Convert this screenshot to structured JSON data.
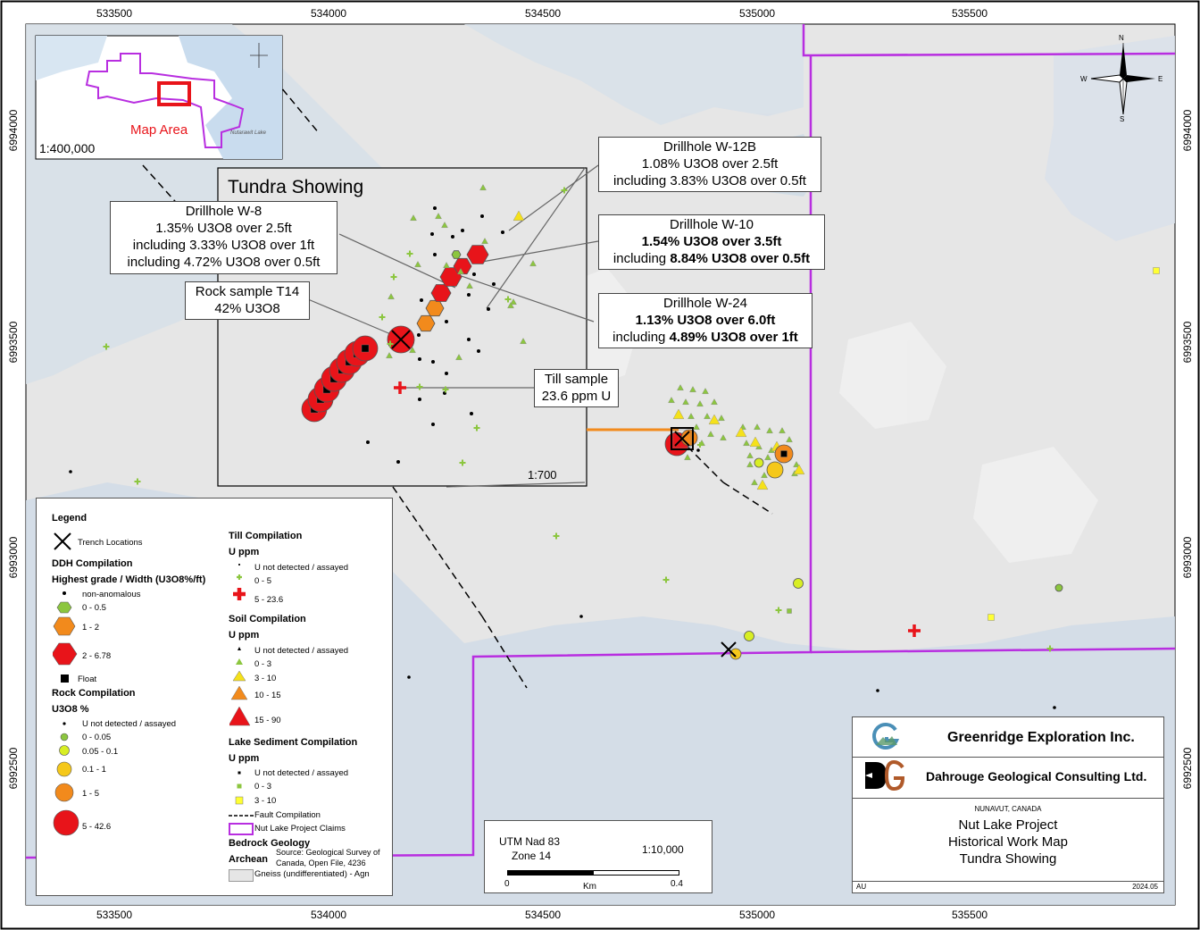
{
  "axes": {
    "easting_ticks": [
      "533500",
      "534000",
      "534500",
      "535000",
      "535500"
    ],
    "northing_ticks": [
      "6994000",
      "6993500",
      "6993000",
      "6992500"
    ]
  },
  "inset": {
    "label": "Map Area",
    "scale": "1:400,000",
    "lake_text": "Nutarawit Lake"
  },
  "detail": {
    "title": "Tundra Showing",
    "scale": "1:700"
  },
  "callouts": {
    "w12b": {
      "title": "Drillhole W-12B",
      "l1": "1.08% U3O8 over 2.5ft",
      "l2": "including 3.83% U3O8 over 0.5ft"
    },
    "w8": {
      "title": "Drillhole W-8",
      "l1": "1.35% U3O8 over 2.5ft",
      "l2": "including 3.33% U3O8 over 1ft",
      "l3": "including 4.72% U3O8 over 0.5ft"
    },
    "w10": {
      "title": "Drillhole W-10",
      "l1": "1.54% U3O8 over 3.5ft",
      "l2a": "including ",
      "l2b": "8.84% U3O8 over 0.5ft"
    },
    "w24": {
      "title": "Drillhole W-24",
      "l1": "1.13% U3O8 over 6.0ft",
      "l2a": "including ",
      "l2b": "4.89% U3O8 over 1ft"
    },
    "t14": {
      "title": "Rock sample T14",
      "l1": "42% U3O8"
    },
    "till": {
      "title": "Till sample",
      "l1": "23.6 ppm U"
    }
  },
  "legend": {
    "title": "Legend",
    "trench": "Trench Locations",
    "ddh_h": "DDH Compilation",
    "ddh_sub": "Highest grade / Width (U3O8%/ft)",
    "ddh_items": [
      "non-anomalous",
      "0 - 0.5",
      "1 - 2",
      "2 - 6.78",
      "Float"
    ],
    "rock_h": "Rock Compilation",
    "rock_sub": "U3O8 %",
    "rock_items": [
      "U not detected / assayed",
      "0 - 0.05",
      "0.05 - 0.1",
      "0.1 - 1",
      "1 - 5",
      "5 - 42.6"
    ],
    "till_h": "Till Compilation",
    "till_sub": "U ppm",
    "till_items": [
      "U not detected / assayed",
      "0 - 5",
      "5 - 23.6"
    ],
    "soil_h": "Soil Compilation",
    "soil_sub": "U ppm",
    "soil_items": [
      "U not detected / assayed",
      "0 - 3",
      "3 - 10",
      "10 - 15",
      "15 - 90"
    ],
    "lake_h": "Lake Sediment Compilation",
    "lake_sub": "U ppm",
    "lake_items": [
      "U not detected / assayed",
      "0 - 3",
      "3 - 10"
    ],
    "fault": "Fault Compilation",
    "claims": "Nut Lake Project Claims",
    "bedrock_h": "Bedrock Geology",
    "archean": "Archean",
    "source1": "Source: Geological Survey of",
    "source2": "Canada, Open File, 4236",
    "gneiss": "Gneiss (undifferentiated) - Agn"
  },
  "scalebar": {
    "datum": "UTM Nad 83",
    "zone": "Zone 14",
    "ratio": "1:10,000",
    "zero": "0",
    "unit": "Km",
    "max": "0.4"
  },
  "titleblock": {
    "company1": "Greenridge Exploration Inc.",
    "company2": "Dahrouge Geological Consulting Ltd.",
    "region": "NUNAVUT, CANADA",
    "project": "Nut Lake Project",
    "maptype": "Historical Work Map",
    "showing": "Tundra Showing",
    "author": "AU",
    "date": "2024.05"
  },
  "north": {
    "n": "N",
    "s": "S",
    "e": "E",
    "w": "W"
  },
  "colors": {
    "frame_bg": "#e6e6e6",
    "water": "#c5d6e6",
    "claims": "#b82ee0",
    "red": "#e8141a",
    "orange": "#f28a1c",
    "yellow": "#f5e11a",
    "green": "#8cc63f",
    "lake_yellow": "#ffff33"
  }
}
